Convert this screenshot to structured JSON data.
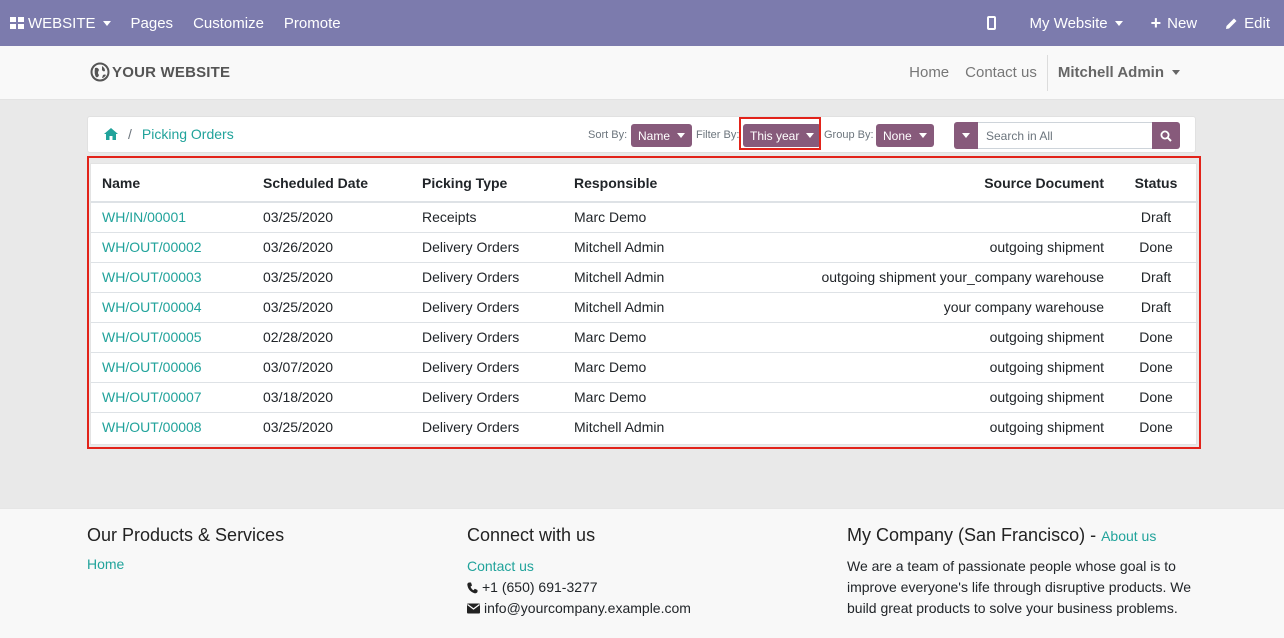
{
  "topbar": {
    "website_label": "WEBSITE",
    "menu": [
      "Pages",
      "Customize",
      "Promote"
    ],
    "my_website_label": "My Website",
    "new_label": "New",
    "edit_label": "Edit"
  },
  "header": {
    "logo_text": "YOUR WEBSITE",
    "nav": [
      "Home",
      "Contact us"
    ],
    "user_name": "Mitchell Admin"
  },
  "breadcrumb": {
    "current": "Picking Orders"
  },
  "controls": {
    "sort_label": "Sort By:",
    "sort_value": "Name",
    "filter_label": "Filter By:",
    "filter_value": "This year",
    "group_label": "Group By:",
    "group_value": "None",
    "search_placeholder": "Search in All"
  },
  "table": {
    "columns": [
      "Name",
      "Scheduled Date",
      "Picking Type",
      "Responsible",
      "Source Document",
      "Status"
    ],
    "rows": [
      [
        "WH/IN/00001",
        "03/25/2020",
        "Receipts",
        "Marc Demo",
        "",
        "Draft"
      ],
      [
        "WH/OUT/00002",
        "03/26/2020",
        "Delivery Orders",
        "Mitchell Admin",
        "outgoing shipment",
        "Done"
      ],
      [
        "WH/OUT/00003",
        "03/25/2020",
        "Delivery Orders",
        "Mitchell Admin",
        "outgoing shipment your_company warehouse",
        "Draft"
      ],
      [
        "WH/OUT/00004",
        "03/25/2020",
        "Delivery Orders",
        "Mitchell Admin",
        "your company warehouse",
        "Draft"
      ],
      [
        "WH/OUT/00005",
        "02/28/2020",
        "Delivery Orders",
        "Marc Demo",
        "outgoing shipment",
        "Done"
      ],
      [
        "WH/OUT/00006",
        "03/07/2020",
        "Delivery Orders",
        "Marc Demo",
        "outgoing shipment",
        "Done"
      ],
      [
        "WH/OUT/00007",
        "03/18/2020",
        "Delivery Orders",
        "Marc Demo",
        "outgoing shipment",
        "Done"
      ],
      [
        "WH/OUT/00008",
        "03/25/2020",
        "Delivery Orders",
        "Mitchell Admin",
        "outgoing shipment",
        "Done"
      ]
    ]
  },
  "footer": {
    "products_title": "Our Products & Services",
    "products_link": "Home",
    "connect_title": "Connect with us",
    "contact_link": "Contact us",
    "phone": "+1 (650) 691-3277",
    "email": "info@yourcompany.example.com",
    "company_title": "My Company (San Francisco) - ",
    "about_link": "About us",
    "company_text": "We are a team of passionate people whose goal is to improve everyone's life through disruptive products. We build great products to solve your business problems."
  },
  "colors": {
    "topbar": "#7c7bad",
    "accent": "#875a7b",
    "link": "#21a39b",
    "highlight": "#e2231a"
  }
}
